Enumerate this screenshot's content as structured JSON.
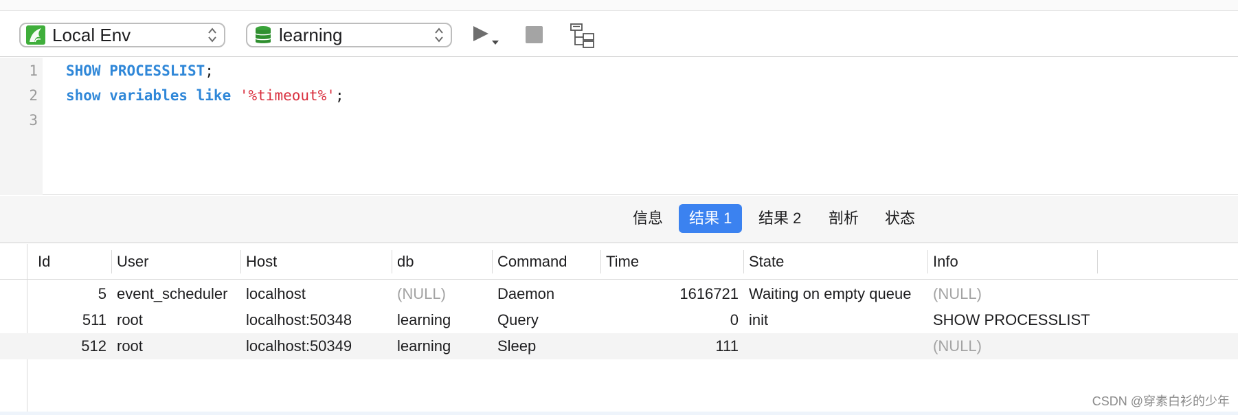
{
  "toolbar": {
    "connection": {
      "label": "Local Env",
      "icon": "mysql-dolphin-icon"
    },
    "database": {
      "label": "learning",
      "icon": "database-icon"
    },
    "run_icon": "play-icon",
    "stop_icon": "stop-icon",
    "explain_icon": "explain-tree-icon"
  },
  "editor": {
    "lines": [
      {
        "number": "1",
        "kw1": "SHOW PROCESSLIST",
        "rest": ";"
      },
      {
        "number": "2",
        "kw1": "show variables like",
        "str": "'%timeout%'",
        "rest": ";"
      },
      {
        "number": "3"
      }
    ]
  },
  "result_tabs": [
    {
      "label": "信息",
      "active": false
    },
    {
      "label": "结果 1",
      "active": true
    },
    {
      "label": "结果 2",
      "active": false
    },
    {
      "label": "剖析",
      "active": false
    },
    {
      "label": "状态",
      "active": false
    }
  ],
  "table": {
    "columns": [
      "Id",
      "User",
      "Host",
      "db",
      "Command",
      "Time",
      "State",
      "Info"
    ],
    "rows": [
      {
        "id": "5",
        "user": "event_scheduler",
        "host": "localhost",
        "db": "(NULL)",
        "command": "Daemon",
        "time": "1616721",
        "state": "Waiting on empty queue",
        "info": "(NULL)"
      },
      {
        "id": "511",
        "user": "root",
        "host": "localhost:50348",
        "db": "learning",
        "command": "Query",
        "time": "0",
        "state": "init",
        "info": "SHOW PROCESSLIST"
      },
      {
        "id": "512",
        "user": "root",
        "host": "localhost:50349",
        "db": "learning",
        "command": "Sleep",
        "time": "111",
        "state": "",
        "info": "(NULL)"
      }
    ]
  },
  "colors": {
    "keyword": "#2f87d8",
    "string": "#d9303f",
    "active_tab": "#3b82f0",
    "null_text": "#a3a3a3"
  },
  "watermark": "CSDN @穿素白衫的少年"
}
